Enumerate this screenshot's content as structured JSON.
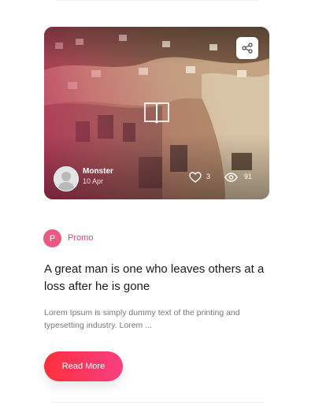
{
  "post": {
    "author": {
      "name": "Monster",
      "date": "10 Apr"
    },
    "likes": "3",
    "views": "91",
    "category": {
      "initial": "P",
      "label": "Promo"
    },
    "title": "A great man is one who leaves others at a loss after he is gone",
    "excerpt": "Lorem Ipsum is simply dummy text of the printing and typesetting industry. Lorem ...",
    "read_more_label": "Read More"
  },
  "icons": {
    "share": "share-icon",
    "format": "book-icon",
    "like": "heart-icon",
    "views": "eye-icon"
  },
  "colors": {
    "accent": "#f83f82",
    "button_start": "#ff2f3c",
    "category_badge": "#e85a82"
  }
}
